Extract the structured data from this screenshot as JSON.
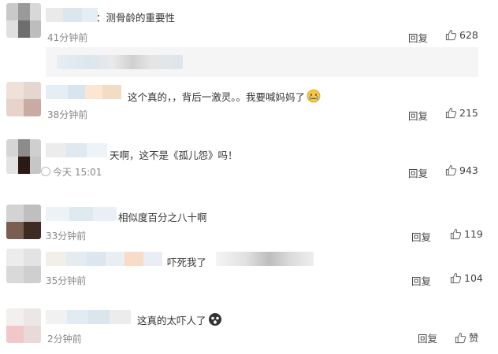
{
  "comments": [
    {
      "text": "：测骨龄的重要性",
      "time": "41分钟前",
      "reply": "回复",
      "likes": "628"
    },
    {
      "text": "这个真的，，背后一激灵。。我要喊妈妈了",
      "time": "38分钟前",
      "reply": "回复",
      "likes": "215"
    },
    {
      "text": "天啊，这不是《孤儿怨》吗！",
      "time": "今天 15:01",
      "reply": "回复",
      "likes": "943"
    },
    {
      "text": "相似度百分之八十啊",
      "time": "33分钟前",
      "reply": "回复",
      "likes": "119"
    },
    {
      "text": "吓死我了",
      "time": "35分钟前",
      "reply": "回复",
      "likes": "104"
    },
    {
      "text": "这真的太吓人了",
      "time": "2分钟前",
      "reply": "回复",
      "likes": "赞"
    }
  ],
  "colors": {
    "background": "#ffffff",
    "card": "#f5f5f5",
    "text": "#333333",
    "meta": "#888888"
  }
}
